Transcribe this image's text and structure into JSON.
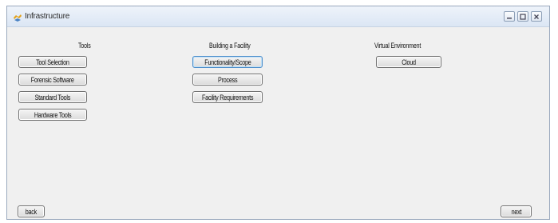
{
  "window": {
    "title": "Infrastructure",
    "controls": {
      "minimize": "minimize-icon",
      "maximize": "maximize-icon",
      "close": "close-icon"
    }
  },
  "sections": {
    "tools": {
      "heading": "Tools",
      "buttons": [
        "Tool Selection",
        "Forensic Software",
        "Standard Tools",
        "Hardware Tools"
      ]
    },
    "facility": {
      "heading": "Building a Facility",
      "buttons": [
        "Functionality/Scope",
        "Process",
        "Facility Requirements"
      ]
    },
    "virtual": {
      "heading": "Virtual Environment",
      "buttons": [
        "Cloud"
      ]
    }
  },
  "footer": {
    "back_label": "back",
    "next_label": "next"
  },
  "colors": {
    "titlebar": "#dbe6f4",
    "accent_border": "#4c8ecb",
    "window_bg": "#f0f0f0"
  }
}
